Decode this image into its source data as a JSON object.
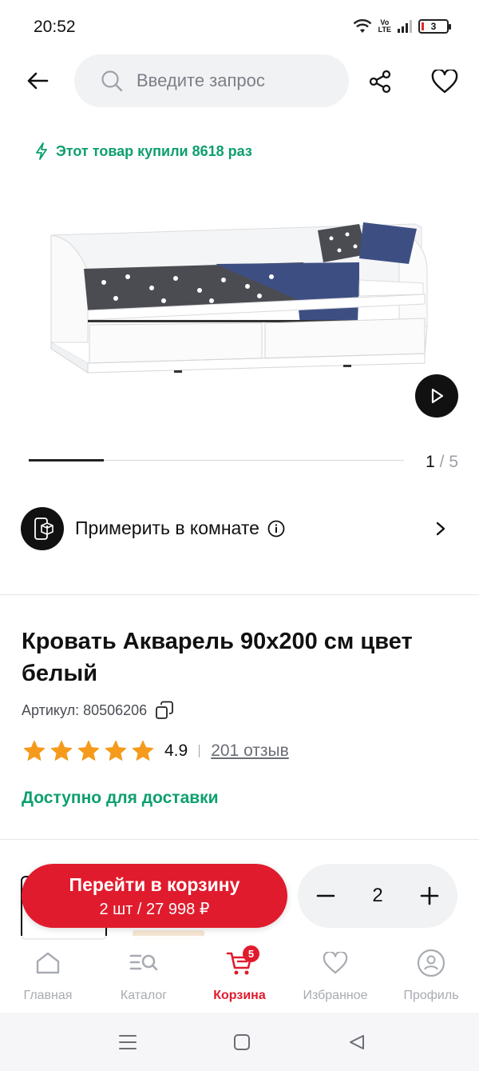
{
  "status_bar": {
    "time": "20:52",
    "volte_top": "Vo",
    "volte_bottom": "LTE",
    "battery": "3"
  },
  "header": {
    "search_placeholder": "Введите запрос"
  },
  "gallery": {
    "bought_text": "Этот товар купили 8618 раз",
    "current": "1",
    "separator": "/",
    "total": "5",
    "progress": 0.2
  },
  "ar": {
    "label": "Примерить в комнате"
  },
  "product": {
    "title": "Кровать Акварель 90x200 см цвет белый",
    "sku": "Артикул: 80506206",
    "rating_value": "4.9",
    "rating_stars": 5,
    "reviews": "201 отзыв",
    "availability": "Доступно для доставки"
  },
  "cart": {
    "button_line1": "Перейти в корзину",
    "button_line2": "2 шт / 27 998 ₽",
    "quantity": "2"
  },
  "bottom_nav": {
    "items": [
      {
        "label": "Главная"
      },
      {
        "label": "Каталог"
      },
      {
        "label": "Корзина",
        "badge": "5"
      },
      {
        "label": "Избранное"
      },
      {
        "label": "Профиль"
      }
    ]
  },
  "colors": {
    "accent_red": "#e01b2d",
    "accent_green": "#0e9f6e",
    "star": "#f59a1b"
  }
}
